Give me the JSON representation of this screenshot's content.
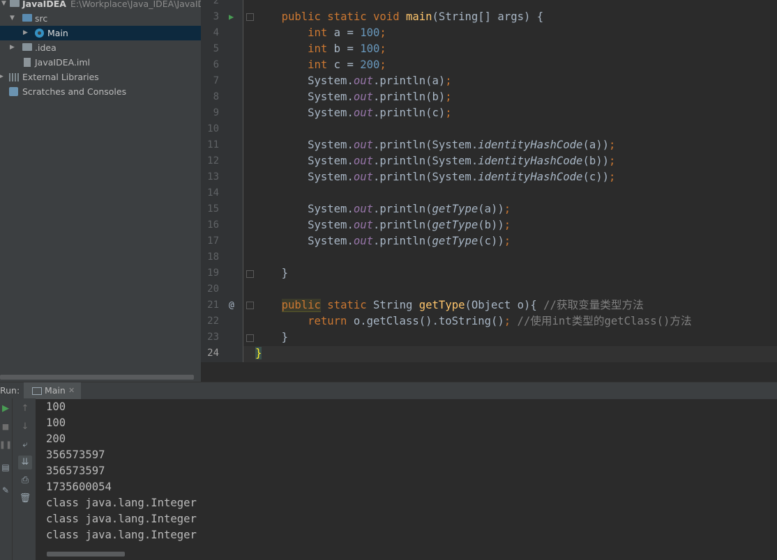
{
  "project": {
    "name": "JavaIDEA",
    "path": "E:\\Workplace\\Java_IDEA\\JavaIDEA",
    "tree": {
      "src": "src",
      "main": "Main",
      "idea": ".idea",
      "iml": "JavaIDEA.iml",
      "external_libraries": "External Libraries",
      "scratches": "Scratches and Consoles"
    }
  },
  "editor": {
    "line_numbers": [
      "2",
      "3",
      "4",
      "5",
      "6",
      "7",
      "8",
      "9",
      "10",
      "11",
      "12",
      "13",
      "14",
      "15",
      "16",
      "17",
      "18",
      "19",
      "20",
      "21",
      "22",
      "23",
      "24"
    ],
    "current_line": "24",
    "code": {
      "l3": [
        "public",
        "static",
        "void",
        "main",
        "(String[] args) {"
      ],
      "l4": [
        "int",
        " a = ",
        "100",
        ";"
      ],
      "l5": [
        "int",
        " b = ",
        "100",
        ";"
      ],
      "l6": [
        "int",
        " c = ",
        "200",
        ";"
      ],
      "l7": [
        "System.",
        "out",
        ".println(a)",
        ";"
      ],
      "l8": [
        "System.",
        "out",
        ".println(b)",
        ";"
      ],
      "l9": [
        "System.",
        "out",
        ".println(c)",
        ";"
      ],
      "l11": [
        "System.",
        "out",
        ".println(System.",
        "identityHashCode",
        "(a))",
        ";"
      ],
      "l12": [
        "System.",
        "out",
        ".println(System.",
        "identityHashCode",
        "(b))",
        ";"
      ],
      "l13": [
        "System.",
        "out",
        ".println(System.",
        "identityHashCode",
        "(c))",
        ";"
      ],
      "l15": [
        "System.",
        "out",
        ".println(",
        "getType",
        "(a))",
        ";"
      ],
      "l16": [
        "System.",
        "out",
        ".println(",
        "getType",
        "(b))",
        ";"
      ],
      "l17": [
        "System.",
        "out",
        ".println(",
        "getType",
        "(c))",
        ";"
      ],
      "l19": "}",
      "l21": [
        "public",
        "static",
        "String",
        "getType",
        "(Object o){ ",
        "//获取变量类型方法"
      ],
      "l22": [
        "return",
        " o.getClass().toString()",
        ";",
        " //使用int类型的getClass()方法"
      ],
      "l23": "}",
      "l24": "}"
    }
  },
  "run": {
    "label": "Run:",
    "tab": "Main",
    "output": [
      "100",
      "100",
      "200",
      "356573597",
      "356573597",
      "1735600054",
      "class java.lang.Integer",
      "class java.lang.Integer",
      "class java.lang.Integer"
    ]
  },
  "icons": {
    "run": "run-icon",
    "stop": "stop-icon",
    "pause": "pause-icon",
    "layout": "layout-icon",
    "pin": "pin-icon",
    "up": "up-arrow-icon",
    "down": "down-arrow-icon",
    "wrap": "soft-wrap-icon",
    "scroll_end": "scroll-to-end-icon",
    "print": "print-icon",
    "trash": "trash-icon"
  },
  "colors": {
    "keyword": "#cc7832",
    "number": "#6897bb",
    "field": "#9876aa",
    "method": "#ffc66d",
    "comment": "#808080",
    "text": "#a9b7c6"
  }
}
